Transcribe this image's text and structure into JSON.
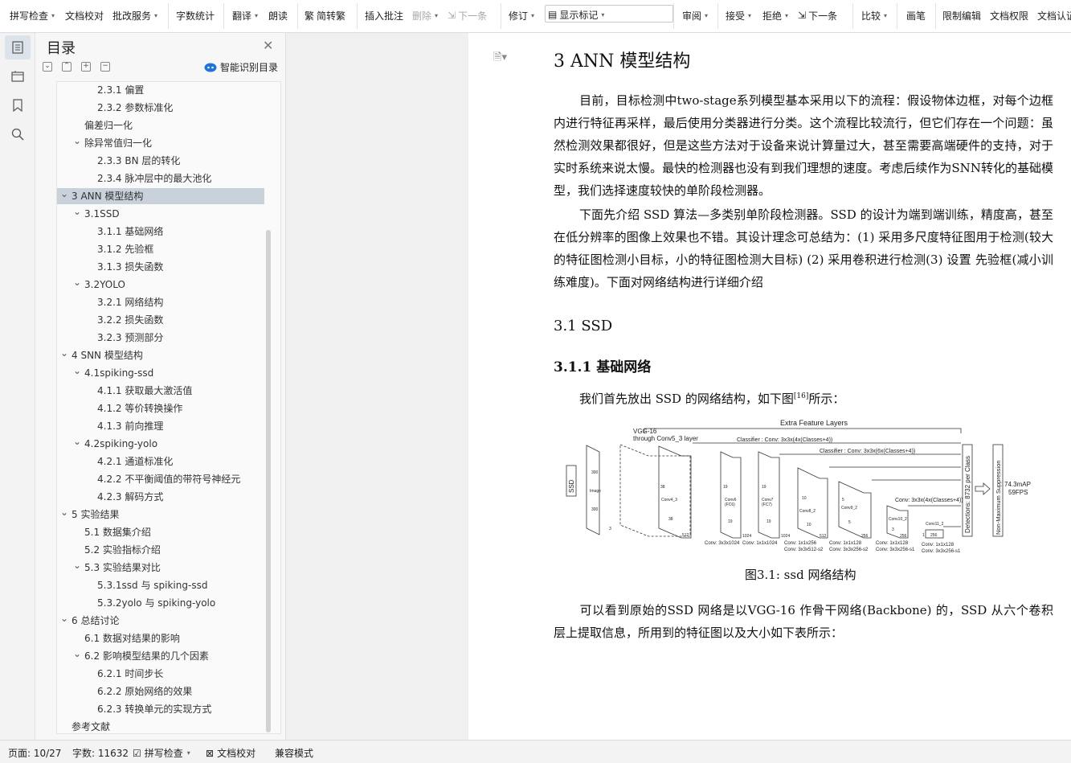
{
  "toolbar": {
    "items": [
      {
        "label": "拼写检查",
        "icon": "spellcheck-icon"
      },
      {
        "label": "文档校对",
        "icon": "proofread-icon"
      },
      {
        "label": "批改服务",
        "icon": "correction-service-icon"
      },
      {
        "label": "字数统计",
        "icon": "word-count-icon"
      },
      {
        "label": "翻译",
        "icon": "translate-icon"
      },
      {
        "label": "朗读",
        "icon": "read-aloud-icon"
      },
      {
        "label": "简转繁",
        "icon": "simplified-to-traditional-icon"
      },
      {
        "label": "插入批注",
        "icon": "insert-comment-icon"
      },
      {
        "label": "删除",
        "icon": "delete-comment-icon"
      },
      {
        "label": "下一条",
        "icon": "next-comment-icon"
      },
      {
        "label": "修订",
        "icon": "revise-icon"
      },
      {
        "label": "显示标记",
        "icon": "show-markup-icon"
      },
      {
        "label": "审阅",
        "icon": "review-icon"
      },
      {
        "label": "接受",
        "icon": "accept-icon"
      },
      {
        "label": "拒绝",
        "icon": "reject-icon"
      },
      {
        "label": "下一条",
        "icon": "next-change-icon"
      },
      {
        "label": "比较",
        "icon": "compare-icon"
      },
      {
        "label": "画笔",
        "icon": "pen-icon"
      },
      {
        "label": "限制编辑",
        "icon": "restrict-editing-icon"
      },
      {
        "label": "文档权限",
        "icon": "doc-permission-icon"
      },
      {
        "label": "文档认证",
        "icon": "doc-certify-icon"
      }
    ]
  },
  "toc": {
    "title": "目录",
    "smart_label": "智能识别目录",
    "items": [
      {
        "text": "2.3.1  偏置",
        "level": 3
      },
      {
        "text": "2.3.2  参数标准化",
        "level": 3
      },
      {
        "text": "偏差归一化",
        "level": 2
      },
      {
        "text": "除异常值归一化",
        "level": 2,
        "expanded": true
      },
      {
        "text": "2.3.3  BN 层的转化",
        "level": 3
      },
      {
        "text": "2.3.4  脉冲层中的最大池化",
        "level": 3
      },
      {
        "text": "3  ANN 模型结构",
        "level": 1,
        "expanded": true,
        "active": true
      },
      {
        "text": "3.1SSD",
        "level": 2,
        "expanded": true
      },
      {
        "text": "3.1.1  基础网络",
        "level": 3
      },
      {
        "text": "3.1.2  先验框",
        "level": 3
      },
      {
        "text": "3.1.3  损失函数",
        "level": 3
      },
      {
        "text": "3.2YOLO",
        "level": 2,
        "expanded": true
      },
      {
        "text": "3.2.1  网络结构",
        "level": 3
      },
      {
        "text": "3.2.2  损失函数",
        "level": 3
      },
      {
        "text": "3.2.3     预测部分",
        "level": 3
      },
      {
        "text": "4  SNN 模型结构",
        "level": 1,
        "expanded": true
      },
      {
        "text": "4.1spiking-ssd",
        "level": 2,
        "expanded": true
      },
      {
        "text": "4.1.1  获取最大激活值",
        "level": 3
      },
      {
        "text": "4.1.2  等价转换操作",
        "level": 3
      },
      {
        "text": "4.1.3  前向推理",
        "level": 3
      },
      {
        "text": "4.2spiking-yolo",
        "level": 2,
        "expanded": true
      },
      {
        "text": "4.2.1  通道标准化",
        "level": 3
      },
      {
        "text": "4.2.2  不平衡阈值的带符号神经元",
        "level": 3
      },
      {
        "text": "4.2.3  解码方式",
        "level": 3
      },
      {
        "text": "5  实验结果",
        "level": 1,
        "expanded": true
      },
      {
        "text": "5.1  数据集介绍",
        "level": 2
      },
      {
        "text": "5.2  实验指标介绍",
        "level": 2
      },
      {
        "text": "5.3  实验结果对比",
        "level": 2,
        "expanded": true
      },
      {
        "text": "5.3.1ssd 与 spiking-ssd",
        "level": 3
      },
      {
        "text": "5.3.2yolo 与 spiking-yolo",
        "level": 3
      },
      {
        "text": "6  总结讨论",
        "level": 1,
        "expanded": true
      },
      {
        "text": "6.1  数据对结果的影响",
        "level": 2
      },
      {
        "text": "6.2  影响模型结果的几个因素",
        "level": 2,
        "expanded": true
      },
      {
        "text": "6.2.1  时间步长",
        "level": 3
      },
      {
        "text": "6.2.2  原始网络的效果",
        "level": 3
      },
      {
        "text": "6.2.3  转换单元的实现方式",
        "level": 3
      },
      {
        "text": "参考文献",
        "level": 1
      }
    ]
  },
  "document": {
    "heading1": "3    ANN 模型结构",
    "para1": "目前，目标检测中two-stage系列模型基本采用以下的流程：假设物体边框，对每个边框内进行特征再采样，最后使用分类器进行分类。这个流程比较流行，但它们存在一个问题：虽然检测效果都很好，但是这些方法对于设备来说计算量过大，甚至需要高端硬件的支持，对于实时系统来说太慢。最快的检测器也没有到我们理想的速度。考虑后续作为SNN转化的基础模型，我们选择速度较快的单阶段检测器。",
    "para2": "下面先介绍 SSD 算法—多类别单阶段检测器。SSD 的设计为端到端训练，精度高，甚至在低分辨率的图像上效果也不错。其设计理念可总结为：(1) 采用多尺度特征图用于检测(较大的特征图检测小目标，小的特征图检测大目标) (2) 采用卷积进行检测(3) 设置 先验框(减小训练难度)。下面对网络结构进行详细介绍",
    "heading2": "3.1    SSD",
    "heading3": "3.1.1    基础网络",
    "para3_before": "我们首先放出 SSD 的网络结构，如下图",
    "para3_ref": "[16]",
    "para3_after": "所示：",
    "caption": "图3.1: ssd 网络结构",
    "para4": "可以看到原始的SSD 网络是以VGG-16 作骨干网络(Backbone) 的，SSD 从六个卷积 层上提取信息，所用到的特征图以及大小如下表所示："
  },
  "figure": {
    "extra": "Extra Feature Layers",
    "vgg1": "VGG-16",
    "vgg2": "through Conv5_3 layer",
    "cls1": "Classifier : Conv: 3x3x(4x(Classes+4))",
    "cls2": "Classifier : Conv: 3x3x(6x(Classes+4))",
    "cls3": "Conv: 3x3x(4x(Classes+4))",
    "ssd": "SSD",
    "image": "Image",
    "n300a": "300",
    "n300b": "300",
    "n3": "3",
    "n38a": "38",
    "n38b": "38",
    "n512": "512",
    "conv43": "Conv4_3",
    "n19a": "19",
    "n19b": "19",
    "n19c": "19",
    "n19d": "19",
    "n1024a": "1024",
    "n1024b": "1024",
    "conv6": "Conv6",
    "fc6": "(FC6)",
    "conv7": "Conv7",
    "fc7": "(FC7)",
    "n10a": "10",
    "n10b": "10",
    "n512b": "512",
    "conv82": "Conv8_2",
    "n5a": "5",
    "n5b": "5",
    "n256a": "256",
    "conv92": "Conv9_2",
    "n3a": "3",
    "n256b": "256",
    "conv102": "Conv10_2",
    "n1": "1",
    "n256c": "256",
    "conv112": "Conv11_2",
    "det": "Detections: 8732  per Class",
    "nms": "Non-Maximum Suppression",
    "map": "74.3mAP",
    "fps": "59FPS",
    "b1": "Conv: 3x3x1024",
    "b2": "Conv: 1x1x1024",
    "b3a": "Conv: 1x1x256",
    "b3b": "Conv: 3x3x512-s2",
    "b4a": "Conv: 1x1x128",
    "b4b": "Conv: 3x3x256-s2",
    "b5a": "Conv: 1x1x128",
    "b5b": "Conv: 3x3x256-s1",
    "b6a": "Conv: 1x1x128",
    "b6b": "Conv: 3x3x256-s1"
  },
  "status": {
    "page": "页面: 10/27",
    "words": "字数: 11632",
    "spell": "拼写检查",
    "proof": "文档校对",
    "compat": "兼容模式"
  },
  "colors": {
    "active_toc": "#c9d2db",
    "accent": "#1e74d9"
  }
}
